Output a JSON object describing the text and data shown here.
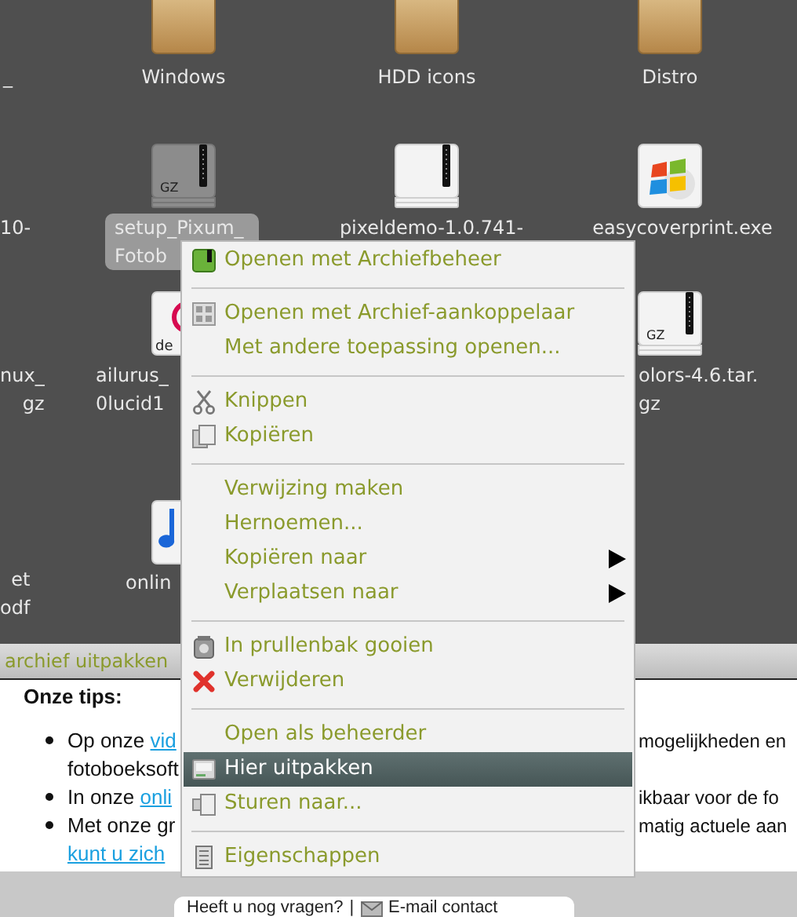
{
  "desktop": {
    "edge_labels": [
      [
        "_"
      ],
      [
        "10-"
      ],
      [
        "nux_",
        "gz"
      ],
      [
        "et",
        "odf"
      ]
    ],
    "icons": [
      {
        "kind": "folder",
        "label": [
          "Windows"
        ],
        "selected": false
      },
      {
        "kind": "folder",
        "label": [
          "HDD icons"
        ],
        "selected": false
      },
      {
        "kind": "folder",
        "label": [
          "Distro"
        ],
        "selected": false
      },
      {
        "kind": "archive",
        "badge": "GZ",
        "label": [
          "setup_Pixum_",
          "Fotob"
        ],
        "selected": true
      },
      {
        "kind": "archive",
        "label": [
          "pixeldemo-1.0.741-"
        ],
        "selected": false
      },
      {
        "kind": "program",
        "label": [
          "easycoverprint.exe"
        ],
        "selected": false
      },
      {
        "kind": "package",
        "badge": "de",
        "label": [
          "ailurus_",
          "0lucid1"
        ],
        "selected": false
      },
      {
        "kind": "archive",
        "badge": "GZ",
        "label": [
          "olors-4.6.tar.",
          "gz"
        ],
        "selected": false
      },
      {
        "kind": "audio",
        "label": [
          "onlin"
        ],
        "selected": false
      }
    ]
  },
  "browser": {
    "title": "archief uitpakken",
    "heading": "Onze tips:",
    "rows": [
      {
        "bullet": true,
        "left": [
          {
            "text": "Op onze "
          },
          {
            "link": "vid"
          }
        ],
        "right": "mogelijkheden en"
      },
      {
        "bullet": false,
        "left": [
          {
            "text": "fotoboeksoft"
          }
        ]
      },
      {
        "bullet": true,
        "left": [
          {
            "text": "In onze "
          },
          {
            "link": "onli"
          }
        ],
        "right": "ikbaar voor de fo"
      },
      {
        "bullet": true,
        "left": [
          {
            "text": "Met onze gr"
          }
        ],
        "right": "matig actuele aan"
      },
      {
        "bullet": false,
        "left": [
          {
            "link": "kunt u zich"
          }
        ]
      }
    ],
    "footer": {
      "question": "Heeft u nog vragen?",
      "divider": "|",
      "contact": "E-mail contact"
    }
  },
  "context_menu": [
    {
      "kind": "archive",
      "label": "Openen met Archiefbeheer",
      "selected": false
    },
    {
      "kind": "separator"
    },
    {
      "kind": "mount",
      "label": "Openen met Archief-aankoppelaar",
      "selected": false
    },
    {
      "kind": "plain",
      "label": "Met andere toepassing openen...",
      "selected": false
    },
    {
      "kind": "separator"
    },
    {
      "kind": "scissors",
      "label": "Knippen",
      "selected": false
    },
    {
      "kind": "copy",
      "label": "Kopiëren",
      "selected": false
    },
    {
      "kind": "separator"
    },
    {
      "kind": "plain",
      "label": "Verwijzing maken",
      "selected": false
    },
    {
      "kind": "plain",
      "label": "Hernoemen...",
      "selected": false
    },
    {
      "kind": "plain",
      "label": "Kopiëren naar",
      "submenu": true,
      "selected": false
    },
    {
      "kind": "plain",
      "label": "Verplaatsen naar",
      "submenu": true,
      "selected": false
    },
    {
      "kind": "separator"
    },
    {
      "kind": "trash",
      "label": "In prullenbak gooien",
      "selected": false
    },
    {
      "kind": "delete",
      "label": "Verwijderen",
      "selected": false
    },
    {
      "kind": "separator"
    },
    {
      "kind": "plain",
      "label": "Open als beheerder",
      "selected": false
    },
    {
      "kind": "drive",
      "label": "Hier uitpakken",
      "selected": true
    },
    {
      "kind": "send",
      "label": "Sturen naar...",
      "selected": false
    },
    {
      "kind": "separator"
    },
    {
      "kind": "properties",
      "label": "Eigenschappen",
      "selected": false
    }
  ]
}
